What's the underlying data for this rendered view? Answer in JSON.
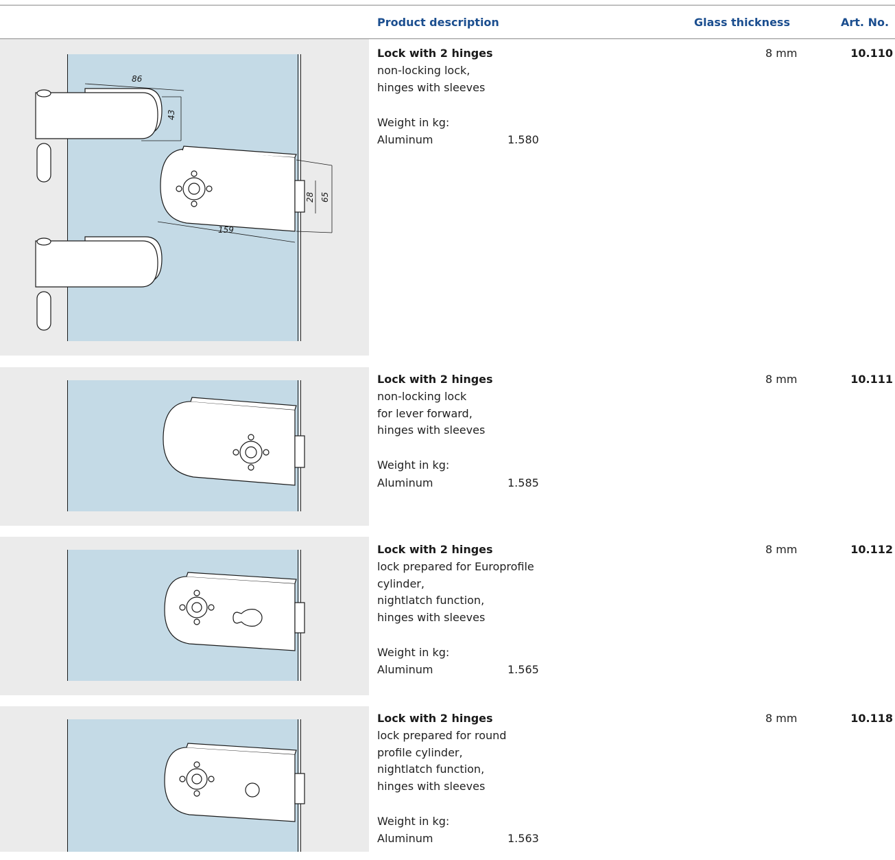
{
  "header": {
    "description": "Product description",
    "glass_thickness": "Glass thickness",
    "art_no": "Art. No."
  },
  "products": [
    {
      "title": "Lock with 2 hinges",
      "lines": [
        "non-locking lock,",
        "hinges with sleeves"
      ],
      "weight_label": "Weight in kg:",
      "material": "Aluminum",
      "weight": "1.580",
      "thickness": "8 mm",
      "art_no": "10.110",
      "dimensions": {
        "hinge_width": "86",
        "hinge_height": "43",
        "lock_length": "159",
        "latch": "28",
        "lock_height": "65"
      }
    },
    {
      "title": "Lock with 2 hinges",
      "lines": [
        "non-locking lock",
        "for lever forward,",
        "hinges with sleeves"
      ],
      "weight_label": "Weight in kg:",
      "material": "Aluminum",
      "weight": "1.585",
      "thickness": "8 mm",
      "art_no": "10.111"
    },
    {
      "title": "Lock with 2 hinges",
      "lines": [
        "lock prepared for Europrofile",
        "cylinder,",
        "nightlatch function,",
        "hinges with sleeves"
      ],
      "weight_label": "Weight in kg:",
      "material": "Aluminum",
      "weight": "1.565",
      "thickness": "8 mm",
      "art_no": "10.112"
    },
    {
      "title": "Lock with 2 hinges",
      "lines": [
        "lock prepared for round",
        "profile cylinder,",
        "nightlatch function,",
        "hinges with sleeves"
      ],
      "weight_label": "Weight in kg:",
      "material": "Aluminum",
      "weight": "1.563",
      "thickness": "8 mm",
      "art_no": "10.118"
    }
  ],
  "colors": {
    "accent": "#1b4e8f",
    "glass": "#c4dae6",
    "panel": "#ebebeb"
  }
}
